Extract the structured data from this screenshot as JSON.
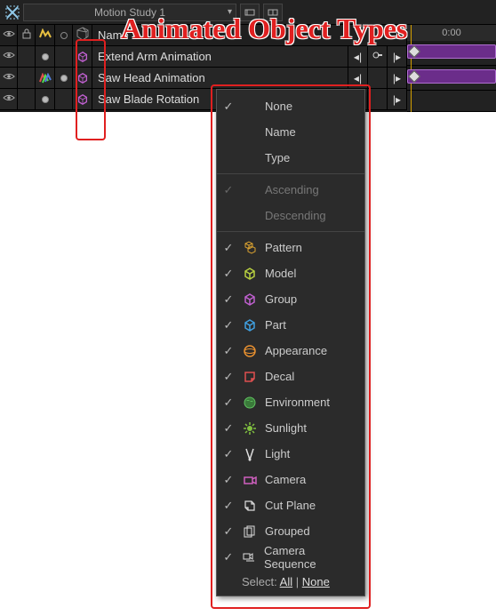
{
  "toolbar": {
    "combo_label": "Motion Study 1"
  },
  "header": {
    "name_col": "Name",
    "time_label": "0:00"
  },
  "tracks": {
    "0": {
      "name": "Extend Arm Animation"
    },
    "1": {
      "name": "Saw Head Animation"
    },
    "2": {
      "name": "Saw Blade Rotation"
    }
  },
  "menu": {
    "sort": {
      "none": "None",
      "name": "Name",
      "type": "Type",
      "asc": "Ascending",
      "desc": "Descending"
    },
    "filters": {
      "pattern": "Pattern",
      "model": "Model",
      "group": "Group",
      "part": "Part",
      "appearance": "Appearance",
      "decal": "Decal",
      "environment": "Environment",
      "sunlight": "Sunlight",
      "light": "Light",
      "camera": "Camera",
      "cutplane": "Cut Plane",
      "grouped": "Grouped",
      "camseq": "Camera Sequence"
    },
    "footer_select": "Select:",
    "footer_all": "All",
    "footer_sep": "|",
    "footer_none": "None"
  },
  "annotation": {
    "title": "Animated Object Types"
  }
}
